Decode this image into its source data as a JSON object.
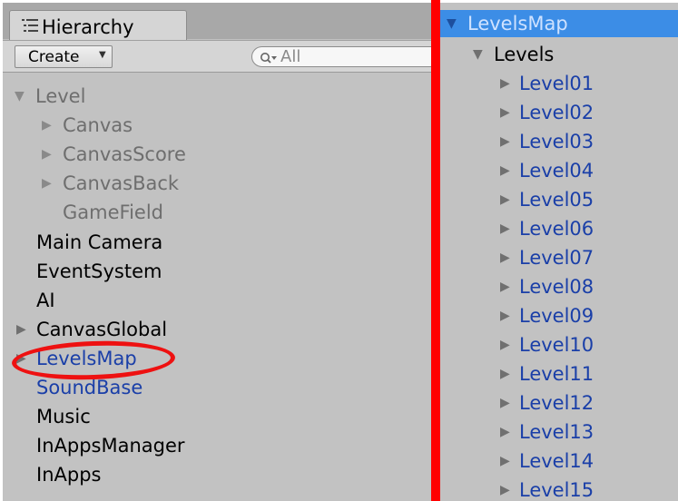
{
  "hierarchy_tab": {
    "label": "Hierarchy",
    "icon": "list-icon"
  },
  "toolbar": {
    "create_label": "Create",
    "search_placeholder": "All"
  },
  "left_tree": [
    {
      "label": "Level",
      "arrow": "▼",
      "style": "disabled"
    },
    {
      "label": "Canvas",
      "arrow": "▶",
      "style": "disabled"
    },
    {
      "label": "CanvasScore",
      "arrow": "▶",
      "style": "disabled"
    },
    {
      "label": "CanvasBack",
      "arrow": "▶",
      "style": "disabled"
    },
    {
      "label": "GameField",
      "arrow": "",
      "style": "disabled"
    },
    {
      "label": "Main Camera",
      "arrow": "",
      "style": "normal"
    },
    {
      "label": "EventSystem",
      "arrow": "",
      "style": "normal"
    },
    {
      "label": "AI",
      "arrow": "",
      "style": "normal"
    },
    {
      "label": "CanvasGlobal",
      "arrow": "▶",
      "style": "normal"
    },
    {
      "label": "LevelsMap",
      "arrow": "▶",
      "style": "prefab"
    },
    {
      "label": "SoundBase",
      "arrow": "",
      "style": "prefab"
    },
    {
      "label": "Music",
      "arrow": "",
      "style": "normal"
    },
    {
      "label": "InAppsManager",
      "arrow": "",
      "style": "normal"
    },
    {
      "label": "InApps",
      "arrow": "",
      "style": "normal"
    }
  ],
  "right_tree": [
    {
      "label": "LevelsMap",
      "arrow": "▼",
      "style": "selected"
    },
    {
      "label": "Levels",
      "arrow": "▼",
      "style": "normal"
    },
    {
      "label": "Level01",
      "arrow": "▶",
      "style": "prefab"
    },
    {
      "label": "Level02",
      "arrow": "▶",
      "style": "prefab"
    },
    {
      "label": "Level03",
      "arrow": "▶",
      "style": "prefab"
    },
    {
      "label": "Level04",
      "arrow": "▶",
      "style": "prefab"
    },
    {
      "label": "Level05",
      "arrow": "▶",
      "style": "prefab"
    },
    {
      "label": "Level06",
      "arrow": "▶",
      "style": "prefab"
    },
    {
      "label": "Level07",
      "arrow": "▶",
      "style": "prefab"
    },
    {
      "label": "Level08",
      "arrow": "▶",
      "style": "prefab"
    },
    {
      "label": "Level09",
      "arrow": "▶",
      "style": "prefab"
    },
    {
      "label": "Level10",
      "arrow": "▶",
      "style": "prefab"
    },
    {
      "label": "Level11",
      "arrow": "▶",
      "style": "prefab"
    },
    {
      "label": "Level12",
      "arrow": "▶",
      "style": "prefab"
    },
    {
      "label": "Level13",
      "arrow": "▶",
      "style": "prefab"
    },
    {
      "label": "Level14",
      "arrow": "▶",
      "style": "prefab"
    },
    {
      "label": "Level15",
      "arrow": "▶",
      "style": "prefab"
    }
  ],
  "colors": {
    "panel_background": "#c2c2c2",
    "selection": "#3c8de6",
    "prefab_text": "#1a3fa8",
    "disabled_text": "#6e6e6e",
    "annotation_red": "#ff0000"
  }
}
